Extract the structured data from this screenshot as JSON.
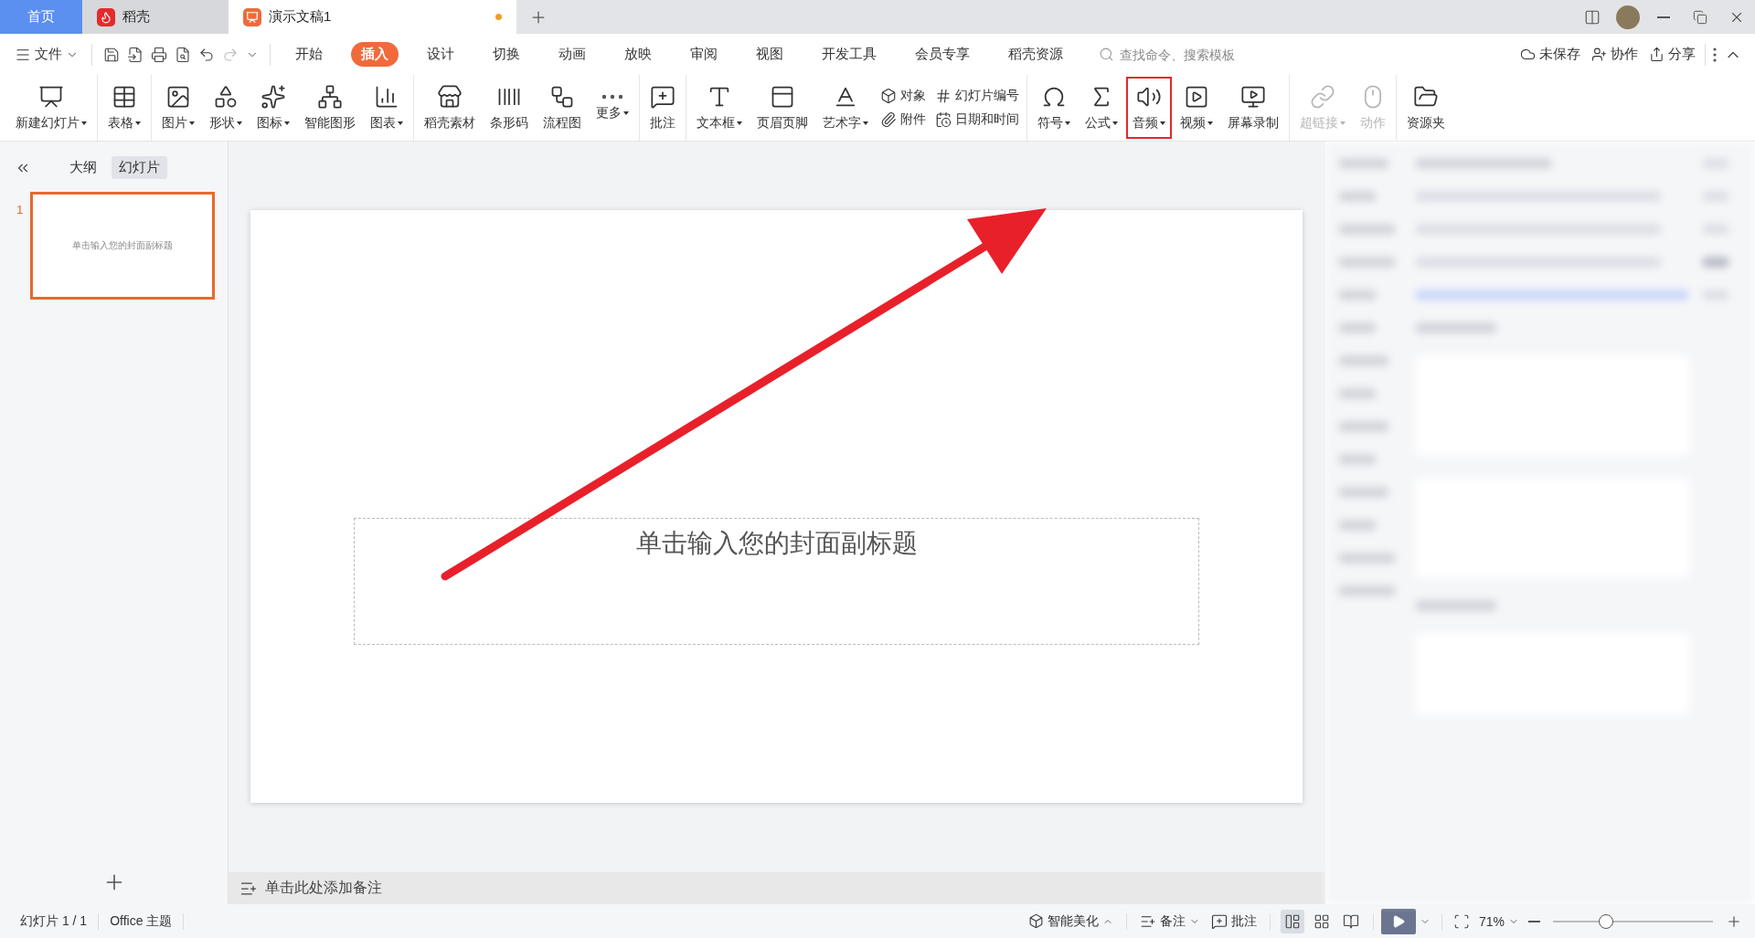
{
  "title_bar": {
    "tabs": [
      {
        "label": "首页",
        "kind": "home",
        "selected": false
      },
      {
        "label": "稻壳",
        "kind": "app",
        "selected": false
      },
      {
        "label": "演示文稿1",
        "kind": "document",
        "selected": true,
        "unsaved": true
      }
    ]
  },
  "menu_bar": {
    "file_menu": "文件",
    "tabs": [
      {
        "label": "开始",
        "selected": false
      },
      {
        "label": "插入",
        "selected": true
      },
      {
        "label": "设计",
        "selected": false
      },
      {
        "label": "切换",
        "selected": false
      },
      {
        "label": "动画",
        "selected": false
      },
      {
        "label": "放映",
        "selected": false
      },
      {
        "label": "审阅",
        "selected": false
      },
      {
        "label": "视图",
        "selected": false
      },
      {
        "label": "开发工具",
        "selected": false
      },
      {
        "label": "会员专享",
        "selected": false
      },
      {
        "label": "稻壳资源",
        "selected": false
      }
    ],
    "search": {
      "placeholder": "查找命令、搜索模板"
    },
    "actions": [
      "未保存",
      "协作",
      "分享"
    ]
  },
  "ribbon": {
    "groups": [
      {
        "items": [
          {
            "kind": "large",
            "label": "新建幻灯片",
            "dropdown": true,
            "disabled": false,
            "highlighted": false
          }
        ]
      },
      {
        "items": [
          {
            "kind": "large",
            "label": "表格",
            "dropdown": true,
            "disabled": false,
            "highlighted": false
          }
        ]
      },
      {
        "items": [
          {
            "kind": "large",
            "label": "图片",
            "dropdown": true,
            "disabled": false,
            "highlighted": false
          },
          {
            "kind": "large",
            "label": "形状",
            "dropdown": true,
            "disabled": false,
            "highlighted": false
          },
          {
            "kind": "large",
            "label": "图标",
            "dropdown": true,
            "disabled": false,
            "highlighted": false
          },
          {
            "kind": "large",
            "label": "智能图形",
            "dropdown": false,
            "disabled": false,
            "highlighted": false
          },
          {
            "kind": "large",
            "label": "图表",
            "dropdown": true,
            "disabled": false,
            "highlighted": false
          }
        ]
      },
      {
        "items": [
          {
            "kind": "large",
            "label": "稻壳素材",
            "dropdown": false,
            "disabled": false,
            "highlighted": false
          },
          {
            "kind": "large",
            "label": "条形码",
            "dropdown": false,
            "disabled": false,
            "highlighted": false
          },
          {
            "kind": "large",
            "label": "流程图",
            "dropdown": false,
            "disabled": false,
            "highlighted": false
          },
          {
            "kind": "large",
            "label": "更多",
            "dropdown": true,
            "disabled": false,
            "highlighted": false
          }
        ]
      },
      {
        "items": [
          {
            "kind": "large",
            "label": "批注",
            "dropdown": false,
            "disabled": false,
            "highlighted": false
          }
        ]
      },
      {
        "items": [
          {
            "kind": "large",
            "label": "文本框",
            "dropdown": true,
            "disabled": false,
            "highlighted": false
          },
          {
            "kind": "large",
            "label": "页眉页脚",
            "dropdown": false,
            "disabled": false,
            "highlighted": false
          },
          {
            "kind": "large",
            "label": "艺术字",
            "dropdown": true,
            "disabled": false,
            "highlighted": false
          },
          {
            "kind": "stack",
            "items": [
              "对象",
              "附件"
            ]
          },
          {
            "kind": "stack",
            "items": [
              "幻灯片编号",
              "日期和时间"
            ]
          }
        ]
      },
      {
        "items": [
          {
            "kind": "large",
            "label": "符号",
            "dropdown": true,
            "disabled": false,
            "highlighted": false
          },
          {
            "kind": "large",
            "label": "公式",
            "dropdown": true,
            "disabled": false,
            "highlighted": false
          },
          {
            "kind": "large",
            "label": "音频",
            "dropdown": true,
            "disabled": false,
            "highlighted": true
          },
          {
            "kind": "large",
            "label": "视频",
            "dropdown": true,
            "disabled": false,
            "highlighted": false
          },
          {
            "kind": "large",
            "label": "屏幕录制",
            "dropdown": false,
            "disabled": false,
            "highlighted": false
          }
        ]
      },
      {
        "items": [
          {
            "kind": "large",
            "label": "超链接",
            "dropdown": true,
            "disabled": true,
            "highlighted": false
          },
          {
            "kind": "large",
            "label": "动作",
            "dropdown": false,
            "disabled": true,
            "highlighted": false
          }
        ]
      },
      {
        "items": [
          {
            "kind": "large",
            "label": "资源夹",
            "dropdown": false,
            "disabled": false,
            "highlighted": false
          }
        ]
      }
    ]
  },
  "slide_panel": {
    "tabs": [
      {
        "label": "大纲",
        "selected": false
      },
      {
        "label": "幻灯片",
        "selected": true
      }
    ],
    "slides": [
      {
        "number": "1",
        "text": "单击输入您的封面副标题",
        "selected": true
      }
    ]
  },
  "slide": {
    "subtitle_placeholder": "单击输入您的封面副标题"
  },
  "notes": {
    "placeholder": "单击此处添加备注"
  },
  "status_bar": {
    "slide_info": "幻灯片 1 / 1",
    "theme": "Office 主题",
    "beautify": "智能美化",
    "notes": "备注",
    "comments": "批注",
    "views": [
      {
        "kind": "normal",
        "selected": true
      },
      {
        "kind": "sorter",
        "selected": false
      },
      {
        "kind": "reading",
        "selected": false
      }
    ],
    "zoom": {
      "reading": "71%",
      "level": 0.33
    }
  }
}
